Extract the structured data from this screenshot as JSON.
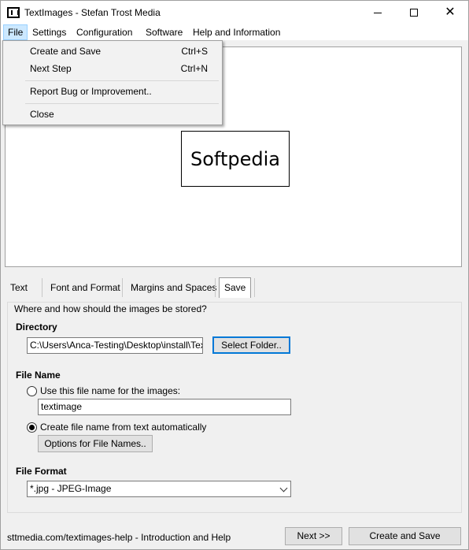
{
  "window": {
    "title": "TextImages - Stefan Trost Media",
    "minimize_icon": "minimize-icon",
    "maximize_icon": "maximize-icon",
    "close_icon": "close-icon",
    "close_glyph": "✕"
  },
  "menu": {
    "items": [
      "File",
      "Settings",
      "Configuration",
      "Software",
      "Help and Information"
    ],
    "active": "File"
  },
  "file_menu": {
    "items": [
      {
        "label": "Create and Save",
        "shortcut": "Ctrl+S"
      },
      {
        "label": "Next Step",
        "shortcut": "Ctrl+N"
      },
      {
        "label": "Report Bug or Improvement..",
        "shortcut": ""
      },
      {
        "label": "Close",
        "shortcut": ""
      }
    ]
  },
  "preview": {
    "text": "Softpedia"
  },
  "tabs": {
    "items": [
      "Text",
      "Font and Format",
      "Margins and Spaces",
      "Save"
    ],
    "selected": "Save"
  },
  "save_panel": {
    "caption": "Where and how should the images be stored?",
    "directory_label": "Directory",
    "directory_value": "C:\\Users\\Anca-Testing\\Desktop\\install\\TextIm",
    "select_folder_label": "Select Folder..",
    "file_name_label": "File Name",
    "radio_use_name_label": "Use this file name for the images:",
    "file_name_value": "textimage",
    "radio_auto_label": "Create file name from text automatically",
    "auto_selected": true,
    "options_button_label": "Options for File Names..",
    "file_format_label": "File Format",
    "file_format_value": "*.jpg - JPEG-Image"
  },
  "footer": {
    "help_text": "sttmedia.com/textimages-help - Introduction and Help",
    "next_label": "Next >>",
    "create_save_label": "Create and Save"
  }
}
